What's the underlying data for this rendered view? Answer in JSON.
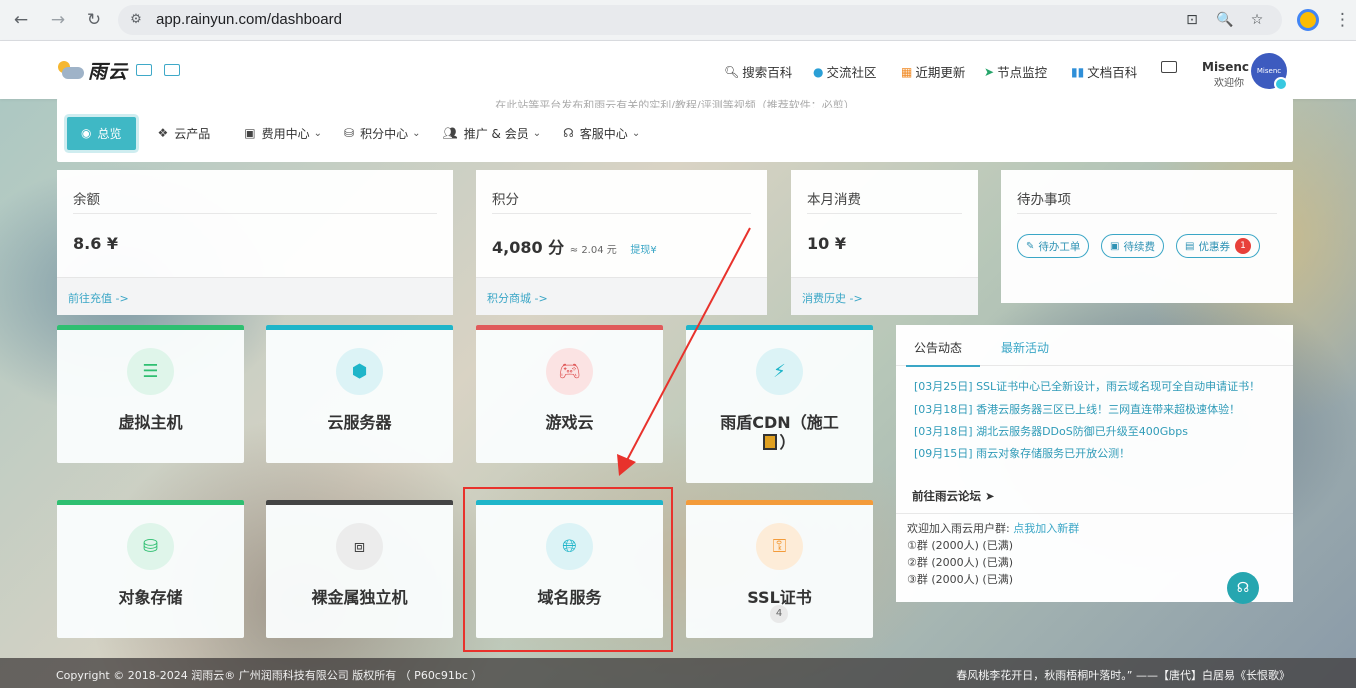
{
  "browser": {
    "url": "app.rainyun.com/dashboard"
  },
  "header": {
    "brand": "雨云",
    "nav": [
      {
        "label": "搜索百科",
        "icon": "search-icon"
      },
      {
        "label": "交流社区",
        "icon": "qq-icon"
      },
      {
        "label": "近期更新",
        "icon": "calendar-icon"
      },
      {
        "label": "节点监控",
        "icon": "paper-plane-icon"
      },
      {
        "label": "文档百科",
        "icon": "book-icon"
      }
    ],
    "user": {
      "name": "Misenc",
      "greeting": "欢迎你",
      "avatar_text": "Misenc"
    }
  },
  "notice": "在此站等平台发布和雨云有关的实利/教程/评测等视频（推荐软件：必剪）",
  "tabs": [
    {
      "label": "总览",
      "icon": "dashboard-icon",
      "active": true
    },
    {
      "label": "云产品",
      "icon": "cubes-icon",
      "dropdown": false
    },
    {
      "label": "费用中心",
      "icon": "money-icon",
      "dropdown": true
    },
    {
      "label": "积分中心",
      "icon": "coins-icon",
      "dropdown": true
    },
    {
      "label": "推广 & 会员",
      "icon": "users-icon",
      "dropdown": true
    },
    {
      "label": "客服中心",
      "icon": "headset-icon",
      "dropdown": true
    }
  ],
  "stats": {
    "balance": {
      "title": "余额",
      "value": "8.6 ¥",
      "link": "前往充值 ->"
    },
    "points": {
      "title": "积分",
      "value": "4,080 分",
      "approx": "≈ 2.04 元",
      "withdraw": "提现¥",
      "link": "积分商城 ->"
    },
    "monthly": {
      "title": "本月消费",
      "value": "10 ¥",
      "link": "消费历史 ->"
    },
    "todo": {
      "title": "待办事项",
      "buttons": [
        "待办工单",
        "待续费",
        "优惠券"
      ],
      "coupon_count": "1"
    }
  },
  "products": [
    {
      "label": "虚拟主机",
      "icon": "server-icon",
      "color": "#2fbf71"
    },
    {
      "label": "云服务器",
      "icon": "cube-icon",
      "color": "#1fb5c9"
    },
    {
      "label": "游戏云",
      "icon": "gamepad-icon",
      "color": "#e05a5a"
    },
    {
      "label": "雨盾CDN（施工",
      "label2": "）",
      "icon": "bolt-icon",
      "color": "#1fb5c9"
    },
    {
      "label": "对象存储",
      "icon": "database-icon",
      "color": "#2fbf71"
    },
    {
      "label": "裸金属独立机",
      "icon": "vector-square-icon",
      "color": "#444444"
    },
    {
      "label": "域名服务",
      "icon": "globe-icon",
      "color": "#1fb5c9"
    },
    {
      "label": "SSL证书",
      "icon": "key-icon",
      "color": "#f39b3a",
      "count": "4"
    }
  ],
  "announcements": {
    "tabs": [
      "公告动态",
      "最新活动"
    ],
    "items": [
      "[03月25日] SSL证书中心已全新设计，雨云域名现可全自动申请证书！",
      "[03月18日] 香港云服务器三区已上线！三网直连带来超极速体验！",
      "[03月18日] 湖北云服务器DDoS防御已升级至400Gbps",
      "[09月15日] 雨云对象存储服务已开放公测！"
    ],
    "forum": "前往雨云论坛",
    "qq_intro": "欢迎加入雨云用户群: ",
    "qq_link": "点我加入新群",
    "groups": [
      "①群 (2000人) (已满)",
      "②群 (2000人) (已满)",
      "③群 (2000人) (已满)"
    ]
  },
  "footer": {
    "copyright": "Copyright © 2018-2024 润雨云® 广州润雨科技有限公司 版权所有 （ P60c91bc ）",
    "poem": "春风桃李花开日，秋雨梧桐叶落时。” ——【唐代】白居易《长恨歌》"
  }
}
